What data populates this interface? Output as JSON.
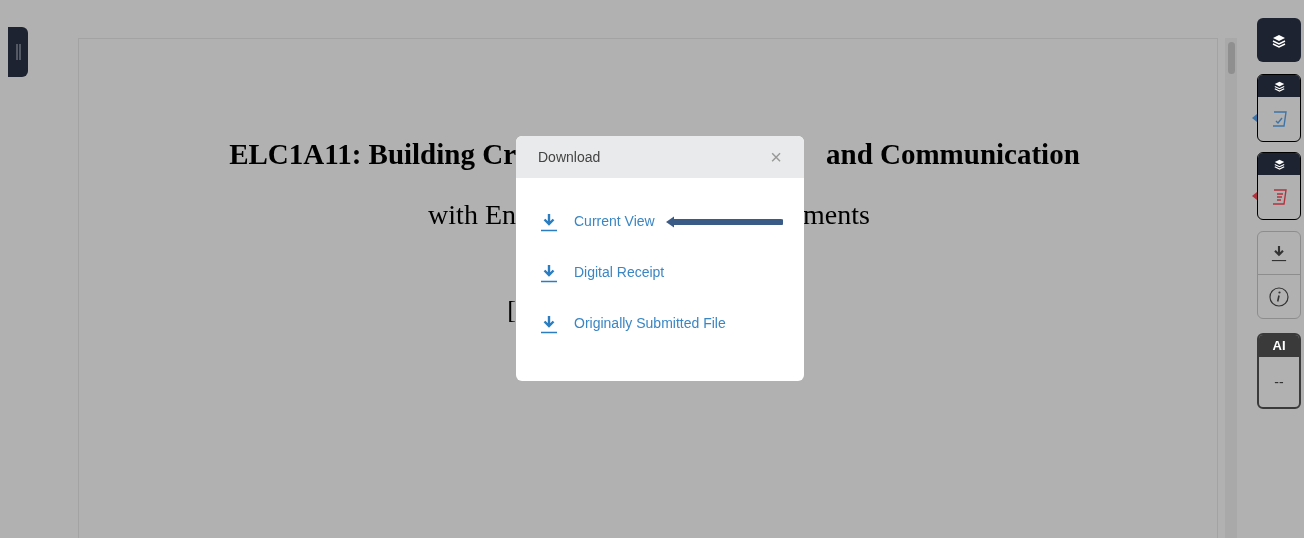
{
  "document": {
    "lines": [
      {
        "kind": "title",
        "left": "ELC1A11: Building Cr",
        "right": "and Communication"
      },
      {
        "kind": "subtitle",
        "left": "with En",
        "right": "ments"
      },
      {
        "kind": "bracket",
        "left": "["
      }
    ]
  },
  "modal": {
    "title": "Download",
    "close": "×",
    "items": [
      {
        "label": "Current View",
        "pointed": true
      },
      {
        "label": "Digital Receipt",
        "pointed": false
      },
      {
        "label": "Originally Submitted File",
        "pointed": false
      }
    ]
  },
  "toolbar": {
    "ai_label": "AI",
    "ai_score": "--"
  }
}
